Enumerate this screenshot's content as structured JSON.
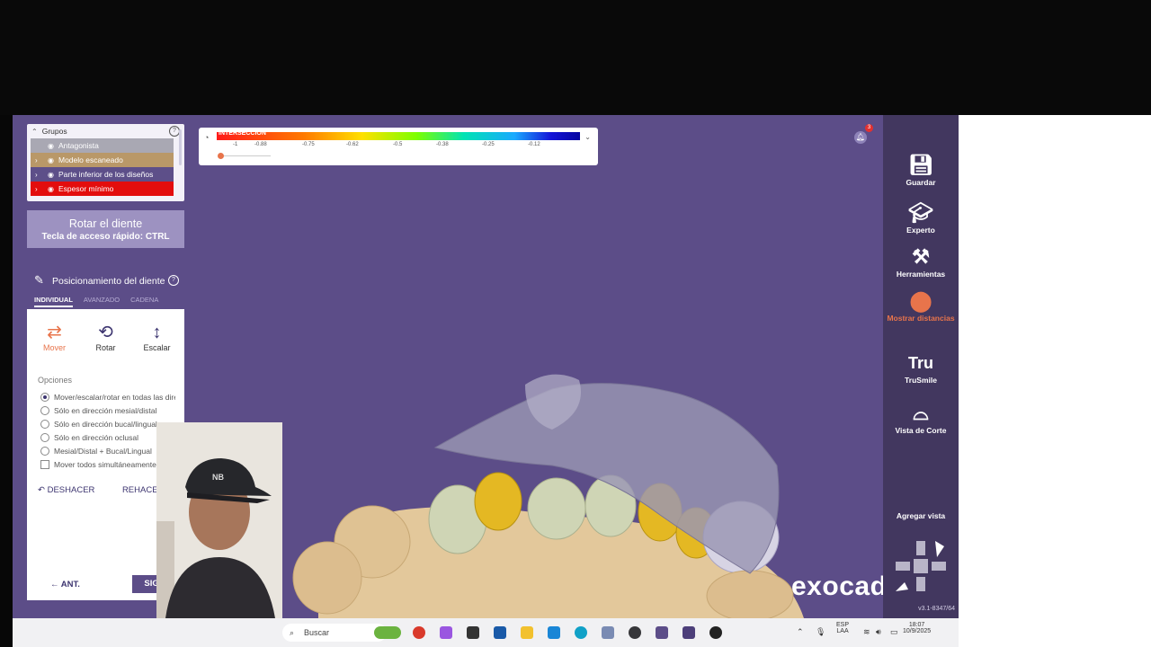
{
  "groups": {
    "title": "Grupos",
    "items": [
      {
        "label": "Antagonista"
      },
      {
        "label": "Modelo escaneado"
      },
      {
        "label": "Parte inferior de los diseños"
      },
      {
        "label": "Espesor mínimo"
      }
    ]
  },
  "banner": {
    "title": "Rotar el diente",
    "shortcut": "Tecla de acceso rápido: CTRL"
  },
  "positioning": {
    "title": "Posicionamiento del diente",
    "tabs": [
      "INDIVIDUAL",
      "AVANZADO",
      "CADENA"
    ],
    "tools": [
      {
        "label": "Mover",
        "icon": "move-arrows-icon"
      },
      {
        "label": "Rotar",
        "icon": "rotate-icon"
      },
      {
        "label": "Escalar",
        "icon": "scale-arrows-icon"
      }
    ],
    "options_title": "Opciones",
    "options": [
      "Mover/escalar/rotar en todas las direcciones",
      "Sólo en dirección mesial/distal",
      "Sólo en dirección bucal/lingual",
      "Sólo en dirección oclusal",
      "Mesial/Distal + Bucal/Lingual"
    ],
    "checkbox": "Mover todos simultáneamente",
    "undo": "DESHACER",
    "redo": "REHACER",
    "prev": "ANT.",
    "next": "SIG."
  },
  "scale": {
    "label": "INTERSECCIÓN",
    "ticks": [
      "-1",
      "-0.88",
      "-0.75",
      "-0.62",
      "-0.5",
      "-0.38",
      "-0.25",
      "-0.12"
    ]
  },
  "notifications": {
    "count": "3"
  },
  "toolbar": [
    {
      "label": "Guardar",
      "icon": "save-icon"
    },
    {
      "label": "Experto",
      "icon": "graduation-cap-icon"
    },
    {
      "label": "Herramientas",
      "icon": "tools-icon"
    },
    {
      "label": "Mostrar distancias",
      "icon": "tooth-distance-icon"
    },
    {
      "label": "TruSmile",
      "icon": "trusmile-icon"
    },
    {
      "label": "Vista de Corte",
      "icon": "cut-view-icon"
    }
  ],
  "add_view": "Agregar vista",
  "version": "v3.1-8347/64",
  "brand": "exocad",
  "taskbar": {
    "search_placeholder": "Buscar",
    "lang": "ESP",
    "lang2": "LAA",
    "time": "18:07",
    "date": "10/9/2025"
  }
}
